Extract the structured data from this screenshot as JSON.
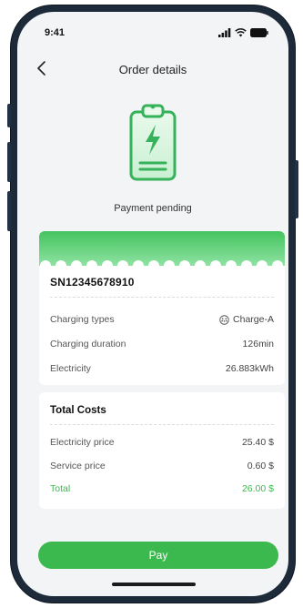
{
  "status_bar": {
    "time": "9:41"
  },
  "nav": {
    "back_icon": "chevron-left-icon",
    "title": "Order details"
  },
  "order_status": {
    "icon": "clipboard-lightning-icon",
    "text": "Payment pending",
    "accent_color": "#3cb94e"
  },
  "order_card": {
    "serial_number": "SN12345678910",
    "rows": [
      {
        "label": "Charging types",
        "value": "Charge-A",
        "icon": "charger-plug-icon"
      },
      {
        "label": "Charging duration",
        "value": "126min"
      },
      {
        "label": "Electricity",
        "value": "26.883kWh"
      }
    ]
  },
  "costs_card": {
    "title": "Total Costs",
    "rows": [
      {
        "label": "Electricity price",
        "value": "25.40 $"
      },
      {
        "label": "Service price",
        "value": "0.60 $"
      },
      {
        "label": "Total",
        "value": "26.00 $"
      }
    ]
  },
  "actions": {
    "pay_label": "Pay"
  },
  "colors": {
    "primary_green": "#3cb94e",
    "background": "#f3f4f6",
    "card": "#ffffff"
  }
}
